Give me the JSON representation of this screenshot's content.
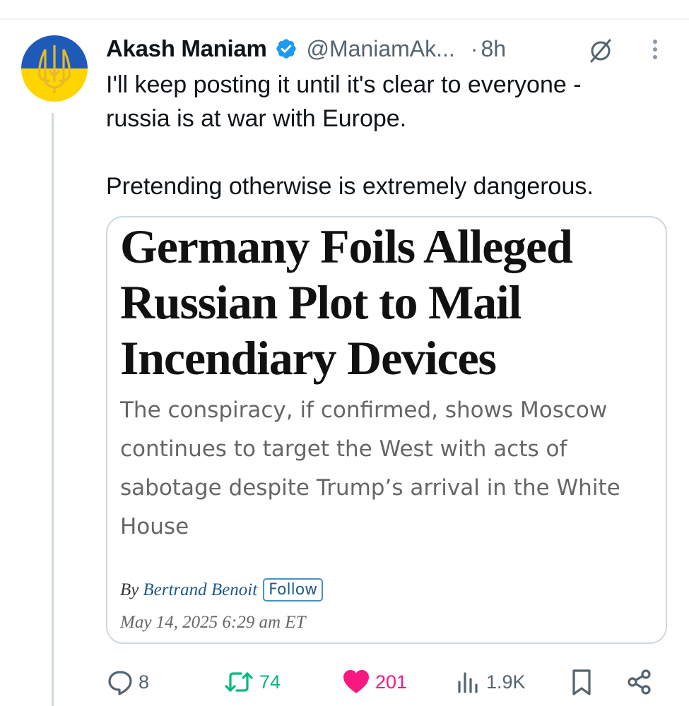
{
  "author": {
    "name": "Akash Maniam",
    "handle": "@ManiamAk...",
    "time": "8h",
    "separator": "·",
    "verified": true,
    "avatar": "ukraine-trident-flag-avatar"
  },
  "tweet": {
    "text": "I'll keep posting it until it's clear to everyone -\nrussia is at war with Europe.\n\nPretending otherwise is extremely dangerous."
  },
  "card": {
    "headline": "Germany Foils Alleged Russian Plot to Mail Incendiary Devices",
    "dek": "The conspiracy, if confirmed, shows Moscow continues to target the West with acts of sabotage despite Trump’s arrival in the White House",
    "byline_prefix": "By",
    "author": "Bertrand Benoit",
    "follow_label": "Follow",
    "date": "May 14, 2025 6:29 am ET"
  },
  "actions": {
    "replies": "8",
    "retweets": "74",
    "likes": "201",
    "views": "1.9K"
  },
  "icons": {
    "reply": "reply-icon",
    "retweet": "retweet-icon",
    "like": "heart-icon",
    "views": "views-icon",
    "bookmark": "bookmark-icon",
    "share": "share-icon",
    "grok": "grok-icon",
    "more": "more-icon",
    "verified": "verified-badge-icon"
  },
  "colors": {
    "verified": "#1d9bf0",
    "retweet": "#00ba7c",
    "like": "#f91880",
    "muted": "#536471",
    "ukraine_blue": "#1e5bb8",
    "ukraine_yellow": "#ffd500",
    "trident": "#e5b92c"
  }
}
